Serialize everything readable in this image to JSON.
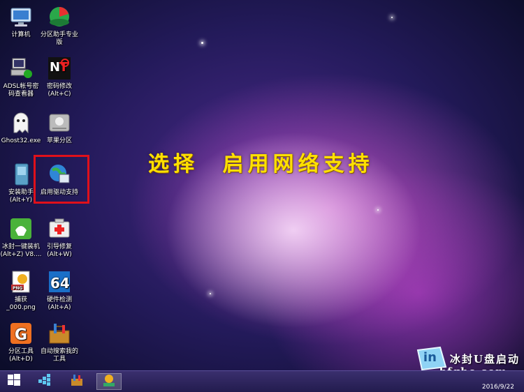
{
  "desktop": {
    "icons": [
      {
        "label": "计算机",
        "icon": "computer-icon"
      },
      {
        "label": "分区助手专业\n版",
        "icon": "partition-assistant-icon"
      },
      {
        "label": "ADSL帐号密\n码查看器",
        "icon": "adsl-viewer-icon"
      },
      {
        "label": "密码修改\n(Alt+C)",
        "icon": "nt-password-icon"
      },
      {
        "label": "Ghost32.exe",
        "icon": "ghost-icon"
      },
      {
        "label": "苹果分区",
        "icon": "apple-partition-icon"
      },
      {
        "label": "安装助手\n(Alt+Y)",
        "icon": "install-helper-icon"
      },
      {
        "label": "启用驱动支持",
        "icon": "network-driver-icon"
      },
      {
        "label": "冰封一键装机\n(Alt+Z) V8....",
        "icon": "bingfeng-installer-icon"
      },
      {
        "label": "引导修复\n(Alt+W)",
        "icon": "boot-repair-icon"
      },
      {
        "label": "捕获\n_000.png",
        "icon": "png-file-icon"
      },
      {
        "label": "硬件检测\n(Alt+A)",
        "icon": "hardware-detect-icon"
      },
      {
        "label": "分区工具\n(Alt+D)",
        "icon": "diskgenius-icon"
      },
      {
        "label": "自动搜索我的\n工具",
        "icon": "toolbox-search-icon"
      }
    ]
  },
  "annotation": {
    "headline": "选择  启用网络支持"
  },
  "brand": {
    "logo_text": "in",
    "title": "冰封U盘启动",
    "url": "bfgho.com"
  },
  "taskbar": {
    "items": [
      "start-icon",
      "grid-app-icon",
      "tools-app-icon",
      "png-viewer-icon"
    ],
    "date": "2016/9/22"
  },
  "colors": {
    "headline": "#ffe000",
    "highlight": "#e0101a",
    "taskbar": "#2b2360"
  }
}
